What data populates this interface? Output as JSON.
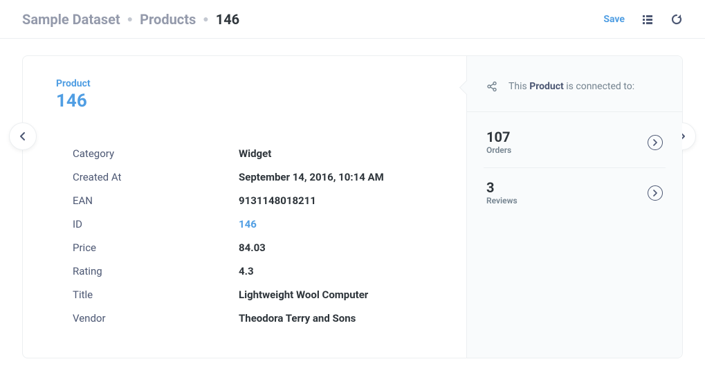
{
  "breadcrumb": {
    "dataset": "Sample Dataset",
    "table": "Products",
    "id": "146"
  },
  "header": {
    "save_label": "Save"
  },
  "entity": {
    "type_label": "Product",
    "id_display": "146"
  },
  "details": [
    {
      "label": "Category",
      "value": "Widget",
      "link": false
    },
    {
      "label": "Created At",
      "value": "September 14, 2016, 10:14 AM",
      "link": false
    },
    {
      "label": "EAN",
      "value": "9131148018211",
      "link": false
    },
    {
      "label": "ID",
      "value": "146",
      "link": true
    },
    {
      "label": "Price",
      "value": "84.03",
      "link": false
    },
    {
      "label": "Rating",
      "value": "4.3",
      "link": false
    },
    {
      "label": "Title",
      "value": "Lightweight Wool Computer",
      "link": false
    },
    {
      "label": "Vendor",
      "value": "Theodora Terry and Sons",
      "link": false
    }
  ],
  "side": {
    "prefix": "This",
    "entity": "Product",
    "suffix": "is connected to:",
    "relations": [
      {
        "count": "107",
        "label": "Orders"
      },
      {
        "count": "3",
        "label": "Reviews"
      }
    ]
  }
}
